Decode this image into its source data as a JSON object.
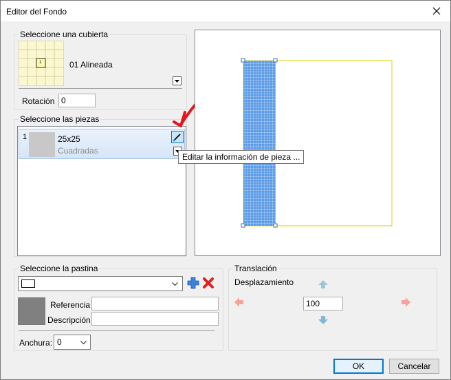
{
  "window": {
    "title": "Editor del Fondo"
  },
  "cover": {
    "group_title": "Seleccione una cubierta",
    "selected_name": "01 Alineada",
    "thumb_number": "1",
    "rotation_label": "Rotación",
    "rotation_value": "0"
  },
  "pieces": {
    "group_title": "Seleccione las piezas",
    "items": [
      {
        "index": "1",
        "size": "25x25",
        "type": "Cuadradas"
      }
    ],
    "tooltip": "Editar la información de pieza ..."
  },
  "grout": {
    "group_title": "Seleccione la pastina",
    "referencia_label": "Referencia",
    "referencia_value": "",
    "descripcion_label": "Descripción",
    "descripcion_value": "",
    "anchura_label": "Anchura:",
    "anchura_value": "0",
    "swatch_color": "#808080"
  },
  "translation": {
    "group_title": "Translación",
    "desplazamiento_label": "Desplazamiento",
    "value": "100"
  },
  "buttons": {
    "ok": "OK",
    "cancel": "Cancelar"
  },
  "colors": {
    "tile_blue": "#4a90e2",
    "outline_yellow": "#e8c900",
    "annotation_red": "#e8141c",
    "arrow_green": "#8fbfd0"
  }
}
